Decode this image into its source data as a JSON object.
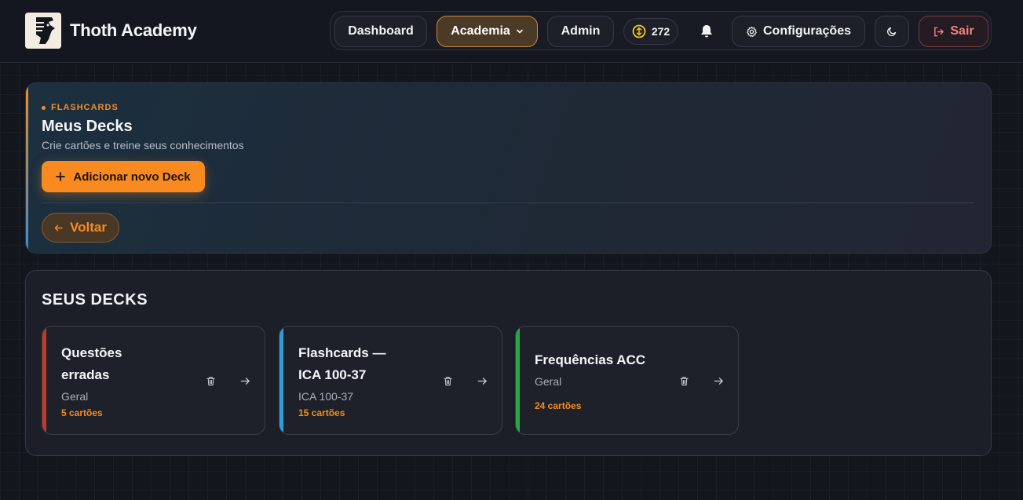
{
  "app": {
    "name": "Thoth Academy"
  },
  "nav": {
    "dashboard": "Dashboard",
    "academia": "Academia",
    "admin": "Admin",
    "coins": "272",
    "settings": "Configurações",
    "logout": "Sair"
  },
  "hero": {
    "eyebrow": "FLASHCARDS",
    "title": "Meus Decks",
    "subtitle": "Crie cartões e treine seus conhecimentos",
    "add_label": "Adicionar novo Deck",
    "back_label": "Voltar"
  },
  "decks": {
    "title": "SEUS DECKS",
    "items": [
      {
        "title_line1": "Questões",
        "title_line2": "erradas",
        "category": "Geral",
        "count": "5 cartões",
        "color": "#c0392b"
      },
      {
        "title_line1": "Flashcards —",
        "title_line2": "ICA 100-37",
        "category": "ICA 100-37",
        "count": "15 cartões",
        "color": "#2e9fdb"
      },
      {
        "title_line1": "Frequências ACC",
        "title_line2": "",
        "category": "Geral",
        "count": "24 cartões",
        "color": "#27a844"
      }
    ]
  },
  "colors": {
    "accent": "#f98a1f",
    "logout": "#f2837f",
    "background": "#14161d"
  }
}
